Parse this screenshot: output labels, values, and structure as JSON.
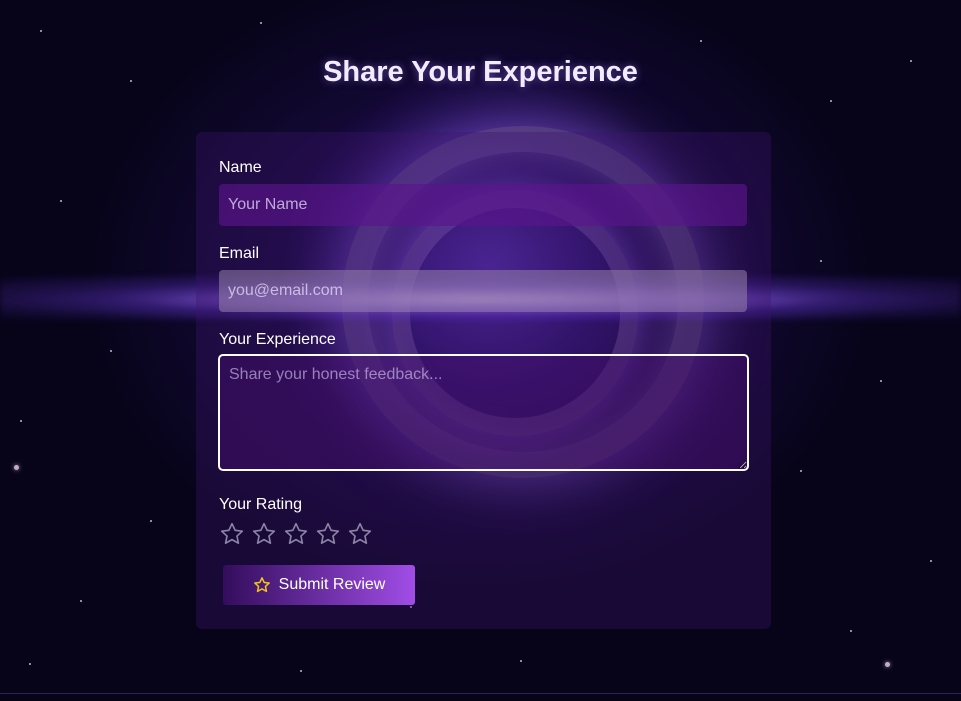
{
  "page": {
    "title": "Share Your Experience"
  },
  "form": {
    "name": {
      "label": "Name",
      "placeholder": "Your Name",
      "value": ""
    },
    "email": {
      "label": "Email",
      "placeholder": "you@email.com",
      "value": ""
    },
    "experience": {
      "label": "Your Experience",
      "placeholder": "Share your honest feedback...",
      "value": ""
    },
    "rating": {
      "label": "Your Rating",
      "max": 5,
      "value": 0,
      "icon": "star-outline-icon"
    },
    "submit": {
      "label": "Submit Review",
      "icon": "star-icon"
    }
  },
  "colors": {
    "background": "#07041a",
    "accent": "#a14de6",
    "star_icon": "#f5c518",
    "star_empty": "#8c86a6"
  }
}
